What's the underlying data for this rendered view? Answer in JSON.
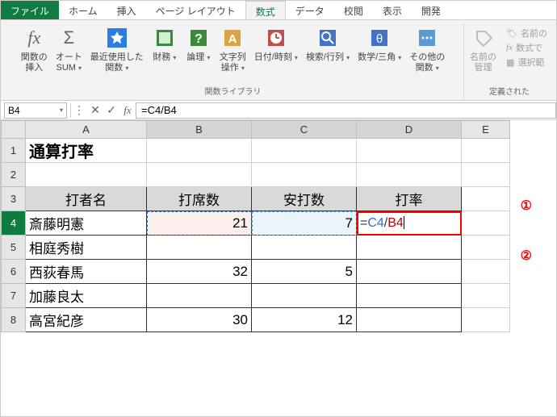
{
  "tabs": {
    "file": "ファイル",
    "home": "ホーム",
    "insert": "挿入",
    "layout": "ページ レイアウト",
    "formulas": "数式",
    "data": "データ",
    "review": "校閲",
    "view": "表示",
    "dev": "開発"
  },
  "ribbon": {
    "insert_fn": "関数の\n挿入",
    "autosum": "オート\nSUM",
    "recent": "最近使用した\n関数",
    "finance": "財務",
    "logic": "論理",
    "text": "文字列\n操作",
    "datetime": "日付/時刻",
    "lookup": "検索/行列",
    "math": "数学/三角",
    "other": "その他の\n関数",
    "name_mgr": "名前の\n管理",
    "def_name": "名前の",
    "use_formula": "数式で",
    "create_sel": "選択範",
    "group_label": "関数ライブラリ",
    "defined_label": "定義された"
  },
  "formula_bar": {
    "name_box": "B4",
    "formula": "=C4/B4"
  },
  "columns": [
    "A",
    "B",
    "C",
    "D",
    "E"
  ],
  "rows": [
    "1",
    "2",
    "3",
    "4",
    "5",
    "6",
    "7",
    "8"
  ],
  "sheet": {
    "title": "通算打率",
    "h1": "打者名",
    "h2": "打席数",
    "h3": "安打数",
    "h4": "打率",
    "r4a": "斎藤明憲",
    "r4b": "21",
    "r4c": "7",
    "edit_eq": "=",
    "edit_r1": "C4",
    "edit_sl": "/",
    "edit_r2": "B4",
    "r5a": "相庭秀樹",
    "r6a": "西荻春馬",
    "r6b": "32",
    "r6c": "5",
    "r7a": "加藤良太",
    "r8a": "高宮紀彦",
    "r8b": "30",
    "r8c": "12"
  },
  "callouts": {
    "c1": "①",
    "c2": "②"
  }
}
